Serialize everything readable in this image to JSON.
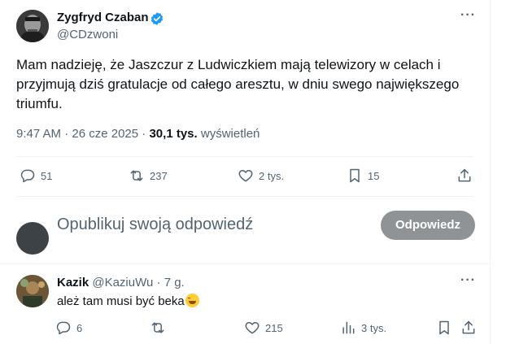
{
  "tweet": {
    "author_name": "Zygfryd Czaban",
    "author_handle": "@CDzwoni",
    "text": "Mam nadzieję, że Jaszczur z Ludwiczkiem mają telewizory w celach i przyjmują dziś gratulacje od całego aresztu, w dniu swego największego triumfu.",
    "time": "9:47 AM",
    "separator": "·",
    "date": "26 cze 2025",
    "views_count": "30,1 tys.",
    "views_label": "wyświetleń",
    "stats": {
      "replies": "51",
      "reposts": "237",
      "likes": "2 tys.",
      "bookmarks": "15"
    },
    "more_icon": "more-dots-icon"
  },
  "composer": {
    "placeholder": "Opublikuj swoją odpowiedź",
    "button_label": "Odpowiedz",
    "button_color": "#8f9396"
  },
  "reply": {
    "author_name": "Kazik",
    "author_handle": "@KaziuWu",
    "separator": "·",
    "time_ago": "7 g.",
    "text": "ależ tam musi być beka",
    "emoji": "grinning-squinting-face",
    "stats": {
      "replies": "6",
      "reposts": "",
      "likes": "215",
      "views": "3 tys."
    }
  },
  "colors": {
    "verified": "#1d9bf0",
    "muted_text": "#536471",
    "primary_text": "#0f1419",
    "divider": "#eff3f4"
  }
}
